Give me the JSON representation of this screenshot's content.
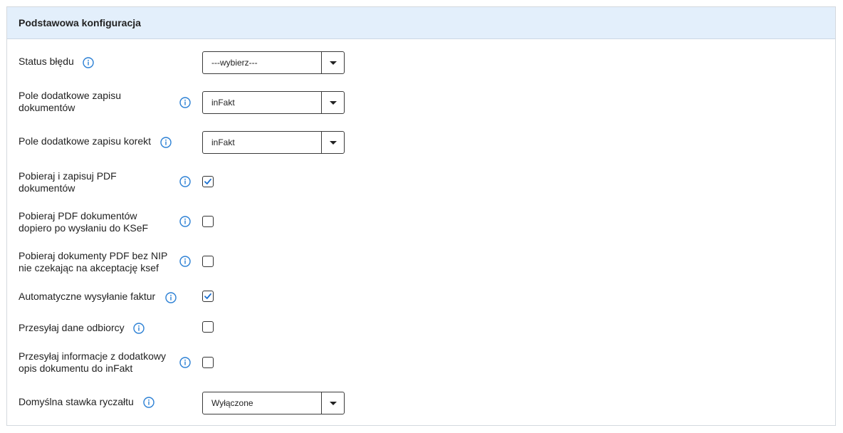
{
  "panel": {
    "title": "Podstawowa konfiguracja"
  },
  "colors": {
    "header_bg": "#e3effb",
    "info_icon": "#2a7fd4",
    "check": "#1a6fd0"
  },
  "fields": {
    "error_status": {
      "label": "Status błędu",
      "value": "---wybierz---",
      "info_icon": "info-icon"
    },
    "doc_extra_field": {
      "label_line1": "Pole dodatkowe zapisu",
      "label_line2": "dokumentów",
      "value": "inFakt",
      "info_icon": "info-icon"
    },
    "corr_extra_field": {
      "label": "Pole dodatkowe zapisu korekt",
      "value": "inFakt",
      "info_icon": "info-icon"
    },
    "fetch_pdf": {
      "label_line1": "Pobieraj i zapisuj PDF",
      "label_line2": "dokumentów",
      "checked": true,
      "info_icon": "info-icon"
    },
    "fetch_pdf_after_ksef": {
      "label_line1": "Pobieraj PDF dokumentów",
      "label_line2": "dopiero po wysłaniu do KSeF",
      "checked": false,
      "info_icon": "info-icon"
    },
    "fetch_pdf_no_nip": {
      "label_line1": "Pobieraj dokumenty PDF bez NIP",
      "label_line2": "nie czekając na akceptację ksef",
      "checked": false,
      "info_icon": "info-icon"
    },
    "auto_send": {
      "label": "Automatyczne wysyłanie faktur",
      "checked": true,
      "info_icon": "info-icon"
    },
    "send_recipient": {
      "label": "Przesyłaj dane odbiorcy",
      "checked": false,
      "info_icon": "info-icon"
    },
    "send_extra_info": {
      "label_line1": "Przesyłaj informacje z dodatkowy",
      "label_line2": "opis dokumentu do inFakt",
      "checked": false,
      "info_icon": "info-icon"
    },
    "default_rate": {
      "label": "Domyślna stawka ryczałtu",
      "value": "Wyłączone",
      "info_icon": "info-icon"
    }
  }
}
